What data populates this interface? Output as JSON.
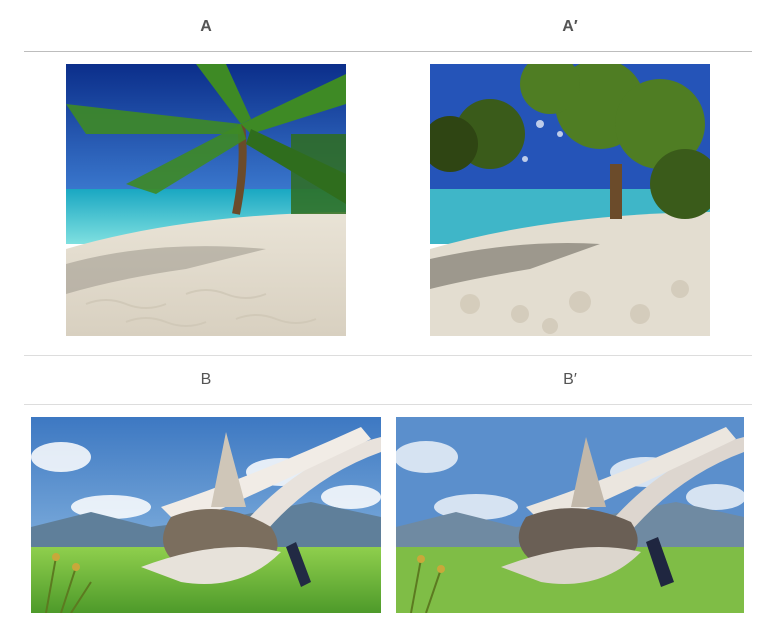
{
  "row1": {
    "left_label": "A",
    "right_label": "A′"
  },
  "row2": {
    "left_label": "B",
    "right_label": "B′"
  }
}
